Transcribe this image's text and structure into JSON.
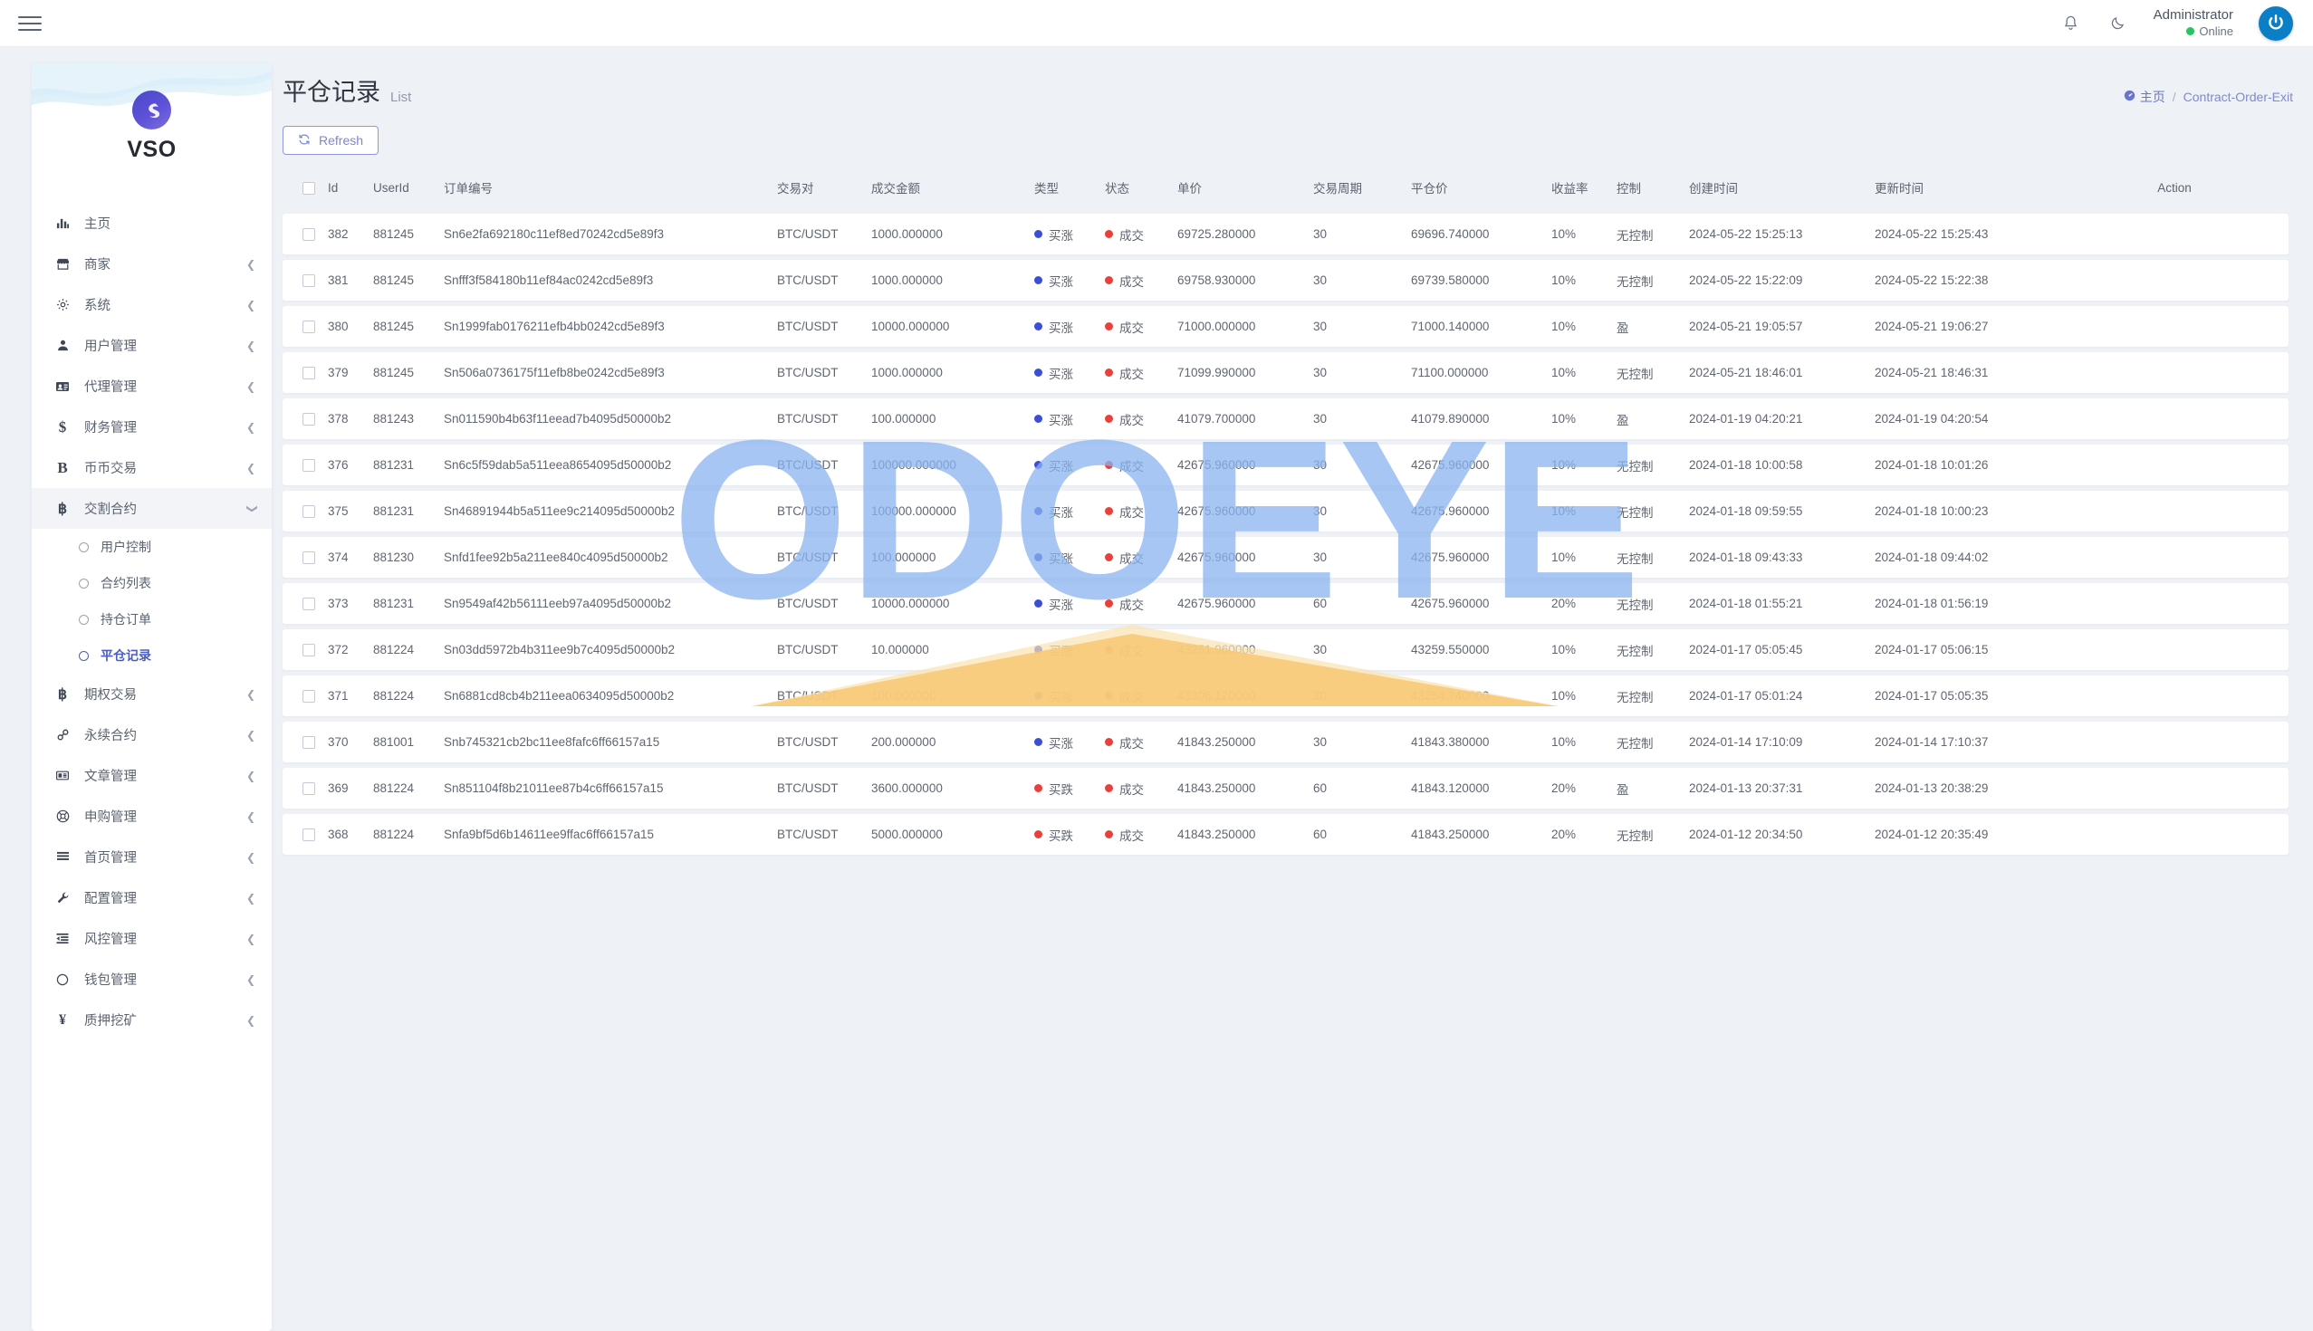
{
  "topbar": {
    "menu_toggle": "hamburger-menu",
    "bell": "bell-icon",
    "theme": "moon-icon",
    "user_name": "Administrator",
    "user_status": "Online",
    "avatar": "power-avatar"
  },
  "sidebar": {
    "brand": "VSO",
    "items": [
      {
        "label": "主页",
        "icon": "chart-bars-icon",
        "expandable": false
      },
      {
        "label": "商家",
        "icon": "store-icon",
        "expandable": true
      },
      {
        "label": "系统",
        "icon": "gear-icon",
        "expandable": true
      },
      {
        "label": "用户管理",
        "icon": "user-icon",
        "expandable": true
      },
      {
        "label": "代理管理",
        "icon": "id-card-icon",
        "expandable": true
      },
      {
        "label": "财务管理",
        "icon": "dollar-icon",
        "expandable": true
      },
      {
        "label": "币币交易",
        "icon": "bold-b-icon",
        "expandable": true
      },
      {
        "label": "交割合约",
        "icon": "bitcoin-icon",
        "expandable": true,
        "open": true,
        "children": [
          {
            "label": "用户控制",
            "active": false
          },
          {
            "label": "合约列表",
            "active": false
          },
          {
            "label": "持仓订单",
            "active": false
          },
          {
            "label": "平仓记录",
            "active": true
          }
        ]
      },
      {
        "label": "期权交易",
        "icon": "bitcoin-icon",
        "expandable": true
      },
      {
        "label": "永续合约",
        "icon": "link-icon",
        "expandable": true
      },
      {
        "label": "文章管理",
        "icon": "news-icon",
        "expandable": true
      },
      {
        "label": "申购管理",
        "icon": "lifebuoy-icon",
        "expandable": true
      },
      {
        "label": "首页管理",
        "icon": "lines-icon",
        "expandable": true
      },
      {
        "label": "配置管理",
        "icon": "wrench-icon",
        "expandable": true
      },
      {
        "label": "风控管理",
        "icon": "indent-icon",
        "expandable": true
      },
      {
        "label": "钱包管理",
        "icon": "circle-icon",
        "expandable": true
      },
      {
        "label": "质押挖矿",
        "icon": "yen-icon",
        "expandable": true
      }
    ]
  },
  "page": {
    "title": "平仓记录",
    "subtitle": "List",
    "breadcrumb_home": "主页",
    "breadcrumb_sep": "/",
    "breadcrumb_current": "Contract-Order-Exit",
    "refresh_label": "Refresh"
  },
  "table": {
    "columns": [
      "",
      "Id",
      "UserId",
      "订单编号",
      "交易对",
      "成交金额",
      "类型",
      "状态",
      "单价",
      "交易周期",
      "平仓价",
      "收益率",
      "控制",
      "创建时间",
      "更新时间",
      "Action"
    ],
    "rows": [
      {
        "id": "382",
        "user_id": "881245",
        "order_no": "Sn6e2fa692180c11ef8ed70242cd5e89f3",
        "pair": "BTC/USDT",
        "amount": "1000.000000",
        "type": "买涨",
        "type_color": "blue",
        "status": "成交",
        "status_color": "red",
        "price": "69725.280000",
        "cycle": "30",
        "close_price": "69696.740000",
        "rate": "10%",
        "control": "无控制",
        "created_at": "2024-05-22 15:25:13",
        "updated_at": "2024-05-22 15:25:43"
      },
      {
        "id": "381",
        "user_id": "881245",
        "order_no": "Snfff3f584180b11ef84ac0242cd5e89f3",
        "pair": "BTC/USDT",
        "amount": "1000.000000",
        "type": "买涨",
        "type_color": "blue",
        "status": "成交",
        "status_color": "red",
        "price": "69758.930000",
        "cycle": "30",
        "close_price": "69739.580000",
        "rate": "10%",
        "control": "无控制",
        "created_at": "2024-05-22 15:22:09",
        "updated_at": "2024-05-22 15:22:38"
      },
      {
        "id": "380",
        "user_id": "881245",
        "order_no": "Sn1999fab0176211efb4bb0242cd5e89f3",
        "pair": "BTC/USDT",
        "amount": "10000.000000",
        "type": "买涨",
        "type_color": "blue",
        "status": "成交",
        "status_color": "red",
        "price": "71000.000000",
        "cycle": "30",
        "close_price": "71000.140000",
        "rate": "10%",
        "control": "盈",
        "created_at": "2024-05-21 19:05:57",
        "updated_at": "2024-05-21 19:06:27"
      },
      {
        "id": "379",
        "user_id": "881245",
        "order_no": "Sn506a0736175f11efb8be0242cd5e89f3",
        "pair": "BTC/USDT",
        "amount": "1000.000000",
        "type": "买涨",
        "type_color": "blue",
        "status": "成交",
        "status_color": "red",
        "price": "71099.990000",
        "cycle": "30",
        "close_price": "71100.000000",
        "rate": "10%",
        "control": "无控制",
        "created_at": "2024-05-21 18:46:01",
        "updated_at": "2024-05-21 18:46:31"
      },
      {
        "id": "378",
        "user_id": "881243",
        "order_no": "Sn011590b4b63f11eead7b4095d50000b2",
        "pair": "BTC/USDT",
        "amount": "100.000000",
        "type": "买涨",
        "type_color": "blue",
        "status": "成交",
        "status_color": "red",
        "price": "41079.700000",
        "cycle": "30",
        "close_price": "41079.890000",
        "rate": "10%",
        "control": "盈",
        "created_at": "2024-01-19 04:20:21",
        "updated_at": "2024-01-19 04:20:54"
      },
      {
        "id": "376",
        "user_id": "881231",
        "order_no": "Sn6c5f59dab5a511eea8654095d50000b2",
        "pair": "BTC/USDT",
        "amount": "100000.000000",
        "type": "买涨",
        "type_color": "blue",
        "status": "成交",
        "status_color": "red",
        "price": "42675.960000",
        "cycle": "30",
        "close_price": "42675.960000",
        "rate": "10%",
        "control": "无控制",
        "created_at": "2024-01-18 10:00:58",
        "updated_at": "2024-01-18 10:01:26"
      },
      {
        "id": "375",
        "user_id": "881231",
        "order_no": "Sn46891944b5a511ee9c214095d50000b2",
        "pair": "BTC/USDT",
        "amount": "100000.000000",
        "type": "买涨",
        "type_color": "blue",
        "status": "成交",
        "status_color": "red",
        "price": "42675.960000",
        "cycle": "30",
        "close_price": "42675.960000",
        "rate": "10%",
        "control": "无控制",
        "created_at": "2024-01-18 09:59:55",
        "updated_at": "2024-01-18 10:00:23"
      },
      {
        "id": "374",
        "user_id": "881230",
        "order_no": "Snfd1fee92b5a211ee840c4095d50000b2",
        "pair": "BTC/USDT",
        "amount": "100.000000",
        "type": "买涨",
        "type_color": "blue",
        "status": "成交",
        "status_color": "red",
        "price": "42675.960000",
        "cycle": "30",
        "close_price": "42675.960000",
        "rate": "10%",
        "control": "无控制",
        "created_at": "2024-01-18 09:43:33",
        "updated_at": "2024-01-18 09:44:02"
      },
      {
        "id": "373",
        "user_id": "881231",
        "order_no": "Sn9549af42b56111eeb97a4095d50000b2",
        "pair": "BTC/USDT",
        "amount": "10000.000000",
        "type": "买涨",
        "type_color": "blue",
        "status": "成交",
        "status_color": "red",
        "price": "42675.960000",
        "cycle": "60",
        "close_price": "42675.960000",
        "rate": "20%",
        "control": "无控制",
        "created_at": "2024-01-18 01:55:21",
        "updated_at": "2024-01-18 01:56:19"
      },
      {
        "id": "372",
        "user_id": "881224",
        "order_no": "Sn03dd5972b4b311ee9b7c4095d50000b2",
        "pair": "BTC/USDT",
        "amount": "10.000000",
        "type": "买涨",
        "type_color": "blue",
        "status": "成交",
        "status_color": "red",
        "price": "43251.960000",
        "cycle": "30",
        "close_price": "43259.550000",
        "rate": "10%",
        "control": "无控制",
        "created_at": "2024-01-17 05:05:45",
        "updated_at": "2024-01-17 05:06:15"
      },
      {
        "id": "371",
        "user_id": "881224",
        "order_no": "Sn6881cd8cb4b211eea0634095d50000b2",
        "pair": "BTC/USDT",
        "amount": "100.000000",
        "type": "买涨",
        "type_color": "blue",
        "status": "成交",
        "status_color": "red",
        "price": "43306.120000",
        "cycle": "30",
        "close_price": "43254.740000",
        "rate": "10%",
        "control": "无控制",
        "created_at": "2024-01-17 05:01:24",
        "updated_at": "2024-01-17 05:05:35"
      },
      {
        "id": "370",
        "user_id": "881001",
        "order_no": "Snb745321cb2bc11ee8fafc6ff66157a15",
        "pair": "BTC/USDT",
        "amount": "200.000000",
        "type": "买涨",
        "type_color": "blue",
        "status": "成交",
        "status_color": "red",
        "price": "41843.250000",
        "cycle": "30",
        "close_price": "41843.380000",
        "rate": "10%",
        "control": "无控制",
        "created_at": "2024-01-14 17:10:09",
        "updated_at": "2024-01-14 17:10:37"
      },
      {
        "id": "369",
        "user_id": "881224",
        "order_no": "Sn851104f8b21011ee87b4c6ff66157a15",
        "pair": "BTC/USDT",
        "amount": "3600.000000",
        "type": "买跌",
        "type_color": "red",
        "status": "成交",
        "status_color": "red",
        "price": "41843.250000",
        "cycle": "60",
        "close_price": "41843.120000",
        "rate": "20%",
        "control": "盈",
        "created_at": "2024-01-13 20:37:31",
        "updated_at": "2024-01-13 20:38:29"
      },
      {
        "id": "368",
        "user_id": "881224",
        "order_no": "Snfa9bf5d6b14611ee9ffac6ff66157a15",
        "pair": "BTC/USDT",
        "amount": "5000.000000",
        "type": "买跌",
        "type_color": "red",
        "status": "成交",
        "status_color": "red",
        "price": "41843.250000",
        "cycle": "60",
        "close_price": "41843.250000",
        "rate": "20%",
        "control": "无控制",
        "created_at": "2024-01-12 20:34:50",
        "updated_at": "2024-01-12 20:35:49"
      }
    ]
  },
  "watermark": {
    "text": "ODOEYE",
    "color": "#8ab4f0",
    "accent": "#f7c873"
  },
  "colors": {
    "accent": "#4b5cc4",
    "blue_tag": "#3b4fd6",
    "red_tag": "#e8413b",
    "online": "#22c55e"
  }
}
